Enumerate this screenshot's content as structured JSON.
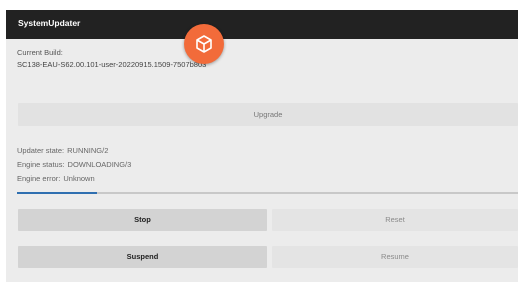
{
  "app": {
    "title": "SystemUpdater"
  },
  "build": {
    "label": "Current Build:",
    "value": "SC138-EAU-S62.00.101-user-20220915.1509-7507b803"
  },
  "buttons": {
    "upgrade": "Upgrade",
    "stop": "Stop",
    "reset": "Reset",
    "suspend": "Suspend",
    "resume": "Resume"
  },
  "status": {
    "updater_label": "Updater state:",
    "updater_value": "RUNNING/2",
    "engine_label": "Engine status:",
    "engine_value": "DOWNLOADING/3",
    "error_label": "Engine error:",
    "error_value": "Unknown"
  },
  "progress": {
    "fraction": 0.16
  },
  "colors": {
    "accent": "#f26b3a",
    "progress": "#2f6fb0",
    "titlebar": "#222222"
  },
  "icons": {
    "fab": "package-cube-icon"
  }
}
